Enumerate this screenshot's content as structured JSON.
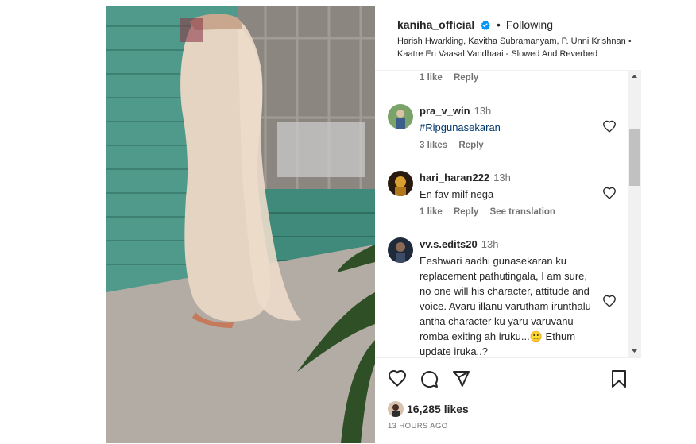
{
  "post": {
    "username": "kaniha_official",
    "follow_status": "Following",
    "audio_line": "Harish Hwarkling, Kavitha Subramanyam, P. Unni Krishnan • Kaatre En Vaasal Vandhaai - Slowed And Reverbed"
  },
  "comments": [
    {
      "id": "prev",
      "meta": {
        "likes": "1 like",
        "reply": "Reply"
      }
    },
    {
      "id": "c1",
      "username": "pra_v_win",
      "time": "13h",
      "text": "#Ripgunasekaran",
      "meta": {
        "likes": "3 likes",
        "reply": "Reply"
      }
    },
    {
      "id": "c2",
      "username": "hari_haran222",
      "time": "13h",
      "text": "En fav milf nega",
      "meta": {
        "likes": "1 like",
        "reply": "Reply",
        "translation": "See translation"
      }
    },
    {
      "id": "c3",
      "username": "vv.s.edits20",
      "time": "13h",
      "text": "Eeshwari aadhi gunasekaran ku replacement pathutingala, I am sure, no one will his character, attitude and voice. Avaru illanu varutham irunthalu antha character ku yaru varuvanu romba exiting ah iruku...🙁 Ethum update iruka..?"
    }
  ],
  "likes": {
    "count": "16,285 likes"
  },
  "timestamp": "13 HOURS AGO",
  "colors": {
    "hashtag": "#00376b",
    "verified": "#0095f6",
    "secondary_text": "#737373"
  },
  "icons": [
    "verified-badge-icon",
    "heart-icon",
    "comment-icon",
    "share-icon",
    "bookmark-icon",
    "scroll-up-icon",
    "scroll-down-icon"
  ]
}
